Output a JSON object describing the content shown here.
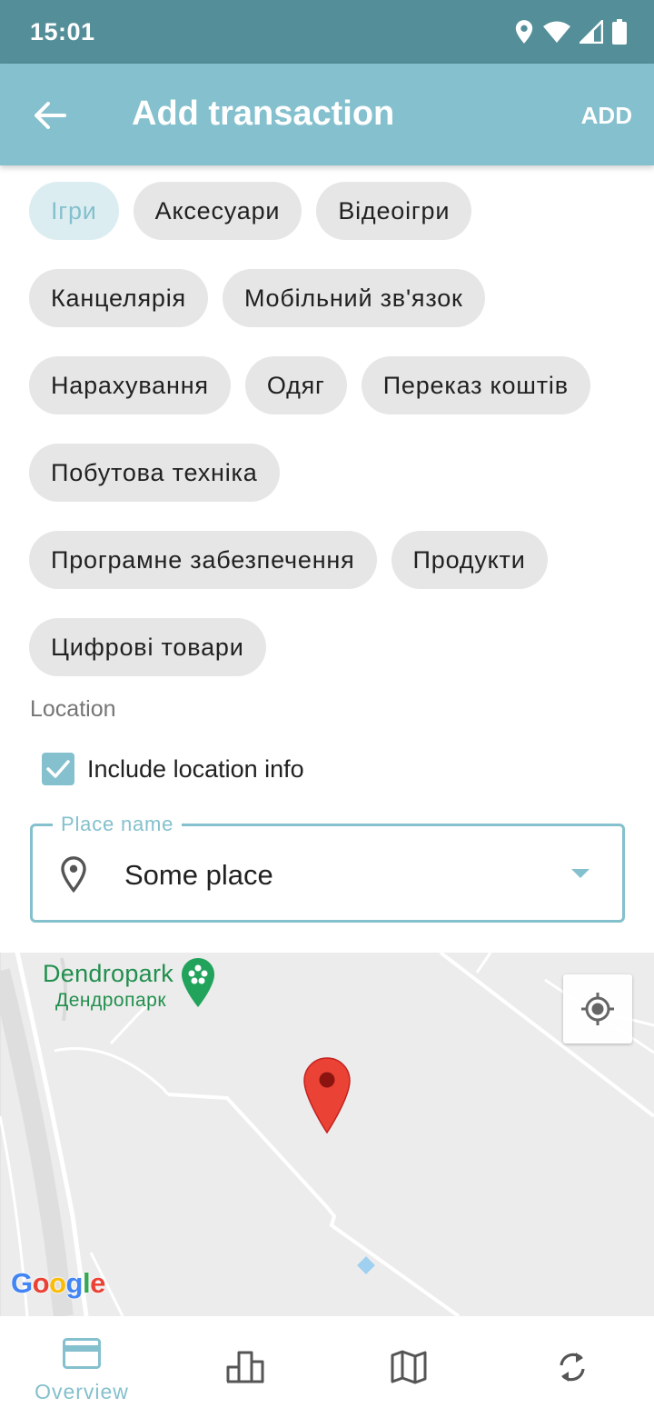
{
  "status_bar": {
    "time": "15:01"
  },
  "app_bar": {
    "title": "Add transaction",
    "action": "ADD"
  },
  "categories": {
    "rows": [
      [
        {
          "label": "Ігри",
          "selected": true
        },
        {
          "label": "Аксесуари"
        },
        {
          "label": "Відеоігри"
        }
      ],
      [
        {
          "label": "Канцелярія"
        },
        {
          "label": "Мобільний зв'язок"
        }
      ],
      [
        {
          "label": "Нарахування"
        },
        {
          "label": "Одяг"
        },
        {
          "label": "Переказ коштів"
        }
      ],
      [
        {
          "label": "Побутова техніка"
        }
      ],
      [
        {
          "label": "Програмне забезпечення"
        },
        {
          "label": "Продукти"
        }
      ],
      [
        {
          "label": "Цифрові товари"
        }
      ]
    ]
  },
  "location": {
    "section_label": "Location",
    "include_label": "Include location info",
    "include_checked": true,
    "place_field_label": "Place name",
    "place_value": "Some place"
  },
  "map": {
    "poi_name": "Dendropark",
    "poi_name_local": "Дендропарк",
    "logo": "Google"
  },
  "bottom_nav": {
    "items": [
      {
        "icon": "credit-card-icon",
        "label": "Overview",
        "active": true
      },
      {
        "icon": "bar-chart-icon",
        "label": "",
        "active": false
      },
      {
        "icon": "map-icon",
        "label": "",
        "active": false
      },
      {
        "icon": "sync-icon",
        "label": "",
        "active": false
      }
    ]
  },
  "colors": {
    "status_bar": "#548f99",
    "accent": "#84c0cd",
    "chip": "#e6e6e6",
    "chip_selected": "#dcedf1",
    "marker": "#ea4335",
    "poi": "#218f4d"
  }
}
